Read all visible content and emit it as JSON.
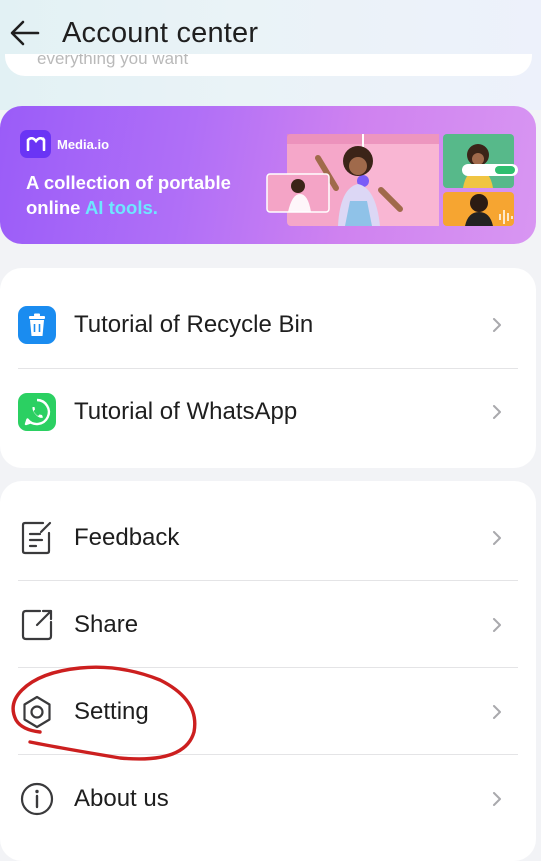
{
  "header": {
    "title": "Account center",
    "back_icon": "arrow-left-icon",
    "partial_text": "everything you want"
  },
  "banner": {
    "brand": "Media.io",
    "headline_part1": "A collection of portable online ",
    "headline_highlight": "AI tools.",
    "colors": {
      "from": "#9a5cf8",
      "to": "#d896f2",
      "highlight": "#6ee7ff"
    }
  },
  "tutorials": [
    {
      "label": "Tutorial of Recycle Bin",
      "icon": "recycle-bin-icon",
      "color": "#1a8cf0"
    },
    {
      "label": "Tutorial of WhatsApp",
      "icon": "whatsapp-icon",
      "color": "#2bd062"
    }
  ],
  "menu": [
    {
      "label": "Feedback",
      "icon": "feedback-icon"
    },
    {
      "label": "Share",
      "icon": "share-icon"
    },
    {
      "label": "Setting",
      "icon": "gear-icon"
    },
    {
      "label": "About us",
      "icon": "info-icon"
    }
  ],
  "annotation": {
    "type": "hand-drawn circle",
    "target": "Setting",
    "color": "#cc1f1f"
  }
}
